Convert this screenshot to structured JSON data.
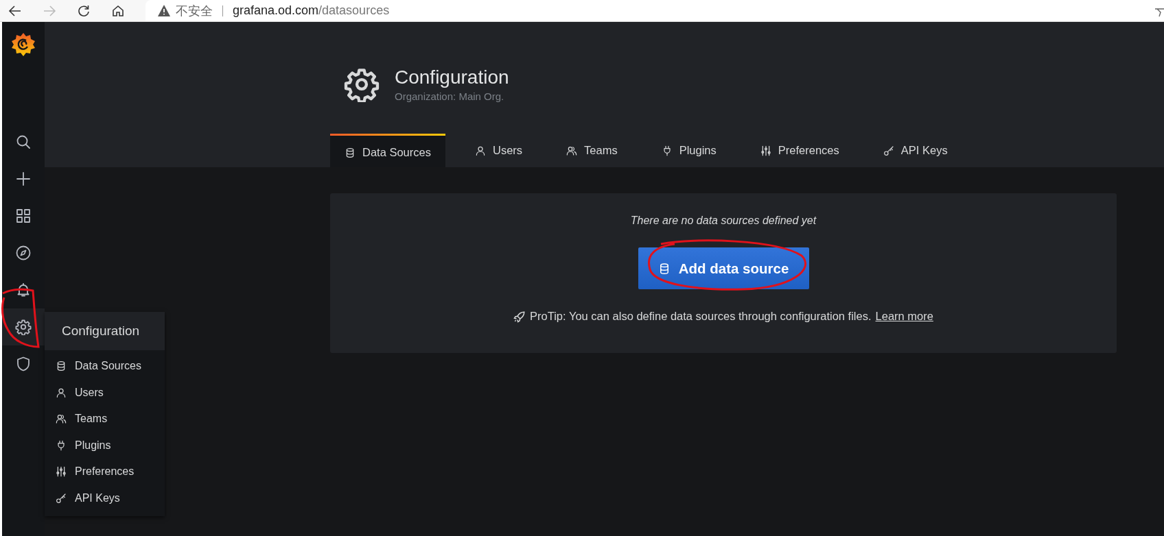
{
  "browser": {
    "security": "不安全",
    "url_host": "grafana.od.com",
    "url_path": "/datasources"
  },
  "sidebar": {
    "items": [
      {
        "kind": "search",
        "selected": false
      },
      {
        "kind": "plus",
        "selected": false
      },
      {
        "kind": "grid",
        "selected": false
      },
      {
        "kind": "compass",
        "selected": false
      },
      {
        "kind": "bell",
        "selected": false
      },
      {
        "kind": "gear",
        "selected": true
      },
      {
        "kind": "shield",
        "selected": false
      }
    ]
  },
  "flyout": {
    "title": "Configuration",
    "items": [
      {
        "kind": "database",
        "label": "Data Sources"
      },
      {
        "kind": "user",
        "label": "Users"
      },
      {
        "kind": "users",
        "label": "Teams"
      },
      {
        "kind": "plug",
        "label": "Plugins"
      },
      {
        "kind": "sliders",
        "label": "Preferences"
      },
      {
        "kind": "key",
        "label": "API Keys"
      }
    ]
  },
  "header": {
    "title": "Configuration",
    "subtitle": "Organization: Main Org."
  },
  "tabs": [
    {
      "kind": "database",
      "label": "Data Sources",
      "selected": true
    },
    {
      "kind": "user",
      "label": "Users",
      "selected": false
    },
    {
      "kind": "users",
      "label": "Teams",
      "selected": false
    },
    {
      "kind": "plug",
      "label": "Plugins",
      "selected": false
    },
    {
      "kind": "sliders",
      "label": "Preferences",
      "selected": false
    },
    {
      "kind": "key",
      "label": "API Keys",
      "selected": false
    }
  ],
  "empty_state": {
    "message": "There are no data sources defined yet",
    "button": "Add data source",
    "tip": "ProTip: You can also define data sources through configuration files.",
    "link": "Learn more"
  }
}
